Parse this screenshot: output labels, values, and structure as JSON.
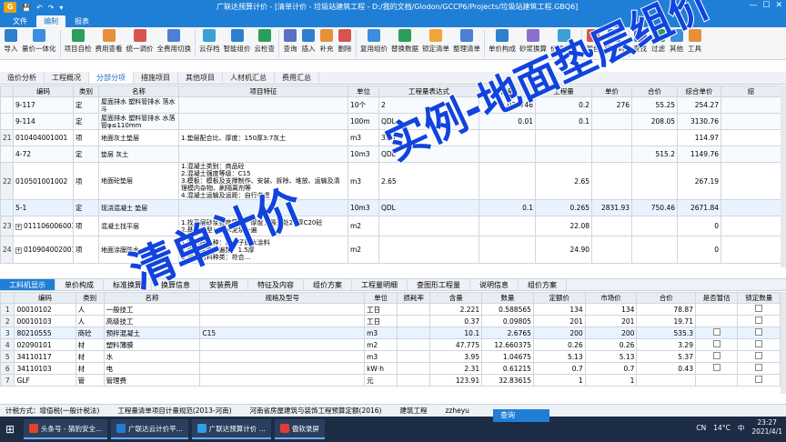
{
  "window": {
    "title": "广联达预算计价 - [清单计价 - 垃圾站建筑工程 - D:/我的文档/Glodon/GCCP6/Projects/垃圾站建筑工程.GBQ6]",
    "logo": "G",
    "controls": [
      "—",
      "☐",
      "✕"
    ]
  },
  "menu": {
    "tabs": [
      "文件",
      "编制",
      "报表"
    ],
    "active": 1
  },
  "ribbon": {
    "buttons": [
      {
        "label": "导入",
        "color": "#2f7fd0"
      },
      {
        "label": "量价一体化",
        "color": "#3b8ee0"
      },
      {
        "label": "项目自检",
        "color": "#2d9d5c"
      },
      {
        "label": "费用查看",
        "color": "#e6903a"
      },
      {
        "label": "统一调价",
        "color": "#d9544f"
      },
      {
        "label": "全费用切换",
        "color": "#4c7fd6"
      },
      {
        "label": "云存档",
        "color": "#3aa0d8"
      },
      {
        "label": "智能组价",
        "color": "#2f7fd0"
      },
      {
        "label": "云检查",
        "color": "#2d9d5c"
      },
      {
        "label": "查询",
        "color": "#5b6fc8"
      },
      {
        "label": "插入",
        "color": "#2f7fd0"
      },
      {
        "label": "补充",
        "color": "#e6903a"
      },
      {
        "label": "删除",
        "color": "#d9544f"
      },
      {
        "label": "复用组价",
        "color": "#3b8ee0"
      },
      {
        "label": "替换数据",
        "color": "#2d9d5c"
      },
      {
        "label": "锁定清单",
        "color": "#f0a43a"
      },
      {
        "label": "整理清单",
        "color": "#4c7fd6"
      },
      {
        "label": "单价构成",
        "color": "#2f7fd0"
      },
      {
        "label": "砂浆换算",
        "color": "#8b6fd0"
      },
      {
        "label": "价格指数",
        "color": "#3aa0d8"
      },
      {
        "label": "颜色",
        "color": "#d9544f"
      },
      {
        "label": "展开到",
        "color": "#2f7fd0"
      },
      {
        "label": "查找",
        "color": "#5b6fc8"
      },
      {
        "label": "过滤",
        "color": "#2d9d5c"
      },
      {
        "label": "其他",
        "color": "#3b8ee0"
      },
      {
        "label": "工具",
        "color": "#e6903a"
      }
    ]
  },
  "section_tabs": {
    "items": [
      "造价分析",
      "工程概况",
      "分部分项",
      "措施项目",
      "其他项目",
      "人材机汇总",
      "费用汇总"
    ],
    "active": 2
  },
  "upper_grid": {
    "headers": [
      "",
      "编码",
      "类别",
      "名称",
      "项目特征",
      "单位",
      "工程量表达式",
      "含量",
      "工程量",
      "单价",
      "合价",
      "综合单价",
      "综"
    ],
    "rows": [
      {
        "no": "",
        "code": "9-117",
        "type": "定",
        "name": "屋面排水 塑料管排水 落水斗",
        "feature": "",
        "unit": "10个",
        "expr": "2",
        "content": "0.031746",
        "qty": "0.2",
        "price": "276",
        "total": "55.25",
        "comp": "254.27",
        "dep": true
      },
      {
        "no": "",
        "code": "9-114",
        "type": "定",
        "name": "屋面排水 塑料管排水 水落管φ≤110mm",
        "feature": "",
        "unit": "100m",
        "expr": "QDL",
        "content": "0.01",
        "qty": "0.1",
        "price": "",
        "total": "208.05",
        "comp": "3130.76",
        "dep": true
      },
      {
        "no": "21",
        "code": "010404001001",
        "type": "项",
        "name": "地面灰土垫层",
        "feature": "1.垫层配合比、厚度：150厚3:7灰土",
        "unit": "m3",
        "expr": "3.31",
        "content": "",
        "qty": "",
        "price": "",
        "total": "",
        "comp": "114.97"
      },
      {
        "no": "",
        "code": "4-72",
        "type": "定",
        "name": "垫层 灰土",
        "feature": "",
        "unit": "10m3",
        "expr": "QDL",
        "content": "",
        "qty": "",
        "price": "",
        "total": "515.2",
        "comp": "1149.76",
        "dep": true
      },
      {
        "no": "22",
        "code": "010501001002",
        "type": "项",
        "name": "地面砼垫层",
        "feature": "1.混凝土类别：商品砼\n2.混凝土强度等级：C15\n3.模板：模板及支撑制作、安装、拆除、堆放、运输及清理模内杂物、刷隔离剂等\n4.混凝土运输及运距：自行考虑",
        "unit": "m3",
        "expr": "2.65",
        "content": "",
        "qty": "2.65",
        "price": "",
        "total": "",
        "comp": "267.19"
      },
      {
        "no": "",
        "code": "5-1",
        "type": "定",
        "name": "现浇混凝土 垫层",
        "feature": "",
        "unit": "10m3",
        "expr": "QDL",
        "content": "0.1",
        "qty": "0.265",
        "price": "2831.93",
        "total": "750.46",
        "comp": "2671.84",
        "dep": true,
        "sel": true
      },
      {
        "no": "23",
        "code": "011106006003",
        "type": "项",
        "name": "混凝土找平层",
        "feature": "1.找平层砂浆强度等级、厚度：最薄处20厚C20砼\n2.基层类型：素水泥浆一遍",
        "unit": "m2",
        "expr": "",
        "content": "",
        "qty": "22.08",
        "price": "",
        "total": "",
        "comp": "0",
        "expand": true
      },
      {
        "no": "24",
        "code": "010904002001",
        "type": "项",
        "name": "地面涂膜防水",
        "feature": "1.防水膜品种：高分子防水涂料\n2.涂膜厚度、遍数：1.5厚\n3.增强材料种类：符合…",
        "unit": "m2",
        "expr": "",
        "content": "",
        "qty": "24.90",
        "price": "",
        "total": "",
        "comp": "0",
        "expand": true
      }
    ]
  },
  "lower_tabs": {
    "items": [
      "工料机显示",
      "单价构成",
      "标准换算",
      "换算信息",
      "安装费用",
      "特征及内容",
      "组价方案",
      "工程量明细",
      "查图形工程量",
      "说明信息",
      "组价方案"
    ],
    "active": 0
  },
  "lower_grid": {
    "headers": [
      "",
      "编码",
      "类别",
      "名称",
      "规格及型号",
      "单位",
      "损耗率",
      "含量",
      "数量",
      "定额价",
      "市场价",
      "合价",
      "是否暂估",
      "锁定数量"
    ],
    "rows": [
      {
        "no": "1",
        "code": "00010102",
        "type": "人",
        "name": "一般技工",
        "spec": "",
        "unit": "工日",
        "loss": "",
        "content": "2.221",
        "qty": "0.588565",
        "base": "134",
        "market": "134",
        "total": "78.87",
        "est": false
      },
      {
        "no": "2",
        "code": "00010103",
        "type": "人",
        "name": "高级技工",
        "spec": "",
        "unit": "工日",
        "loss": "",
        "content": "0.37",
        "qty": "0.09805",
        "base": "201",
        "market": "201",
        "total": "19.71",
        "est": false
      },
      {
        "no": "3",
        "code": "80210555",
        "type": "商砼",
        "name": "预拌混凝土",
        "spec": "C15",
        "unit": "m3",
        "loss": "",
        "content": "10.1",
        "qty": "2.6765",
        "base": "200",
        "market": "200",
        "total": "535.3",
        "est": true,
        "sel": true
      },
      {
        "no": "4",
        "code": "02090101",
        "type": "材",
        "name": "塑料薄膜",
        "spec": "",
        "unit": "m2",
        "loss": "",
        "content": "47.775",
        "qty": "12.660375",
        "base": "0.26",
        "market": "0.26",
        "total": "3.29",
        "est": true
      },
      {
        "no": "5",
        "code": "34110117",
        "type": "材",
        "name": "水",
        "spec": "",
        "unit": "m3",
        "loss": "",
        "content": "3.95",
        "qty": "1.04675",
        "base": "5.13",
        "market": "5.13",
        "total": "5.37",
        "est": true
      },
      {
        "no": "6",
        "code": "34110103",
        "type": "材",
        "name": "电",
        "spec": "",
        "unit": "kW·h",
        "loss": "",
        "content": "2.31",
        "qty": "0.61215",
        "base": "0.7",
        "market": "0.7",
        "total": "0.43",
        "est": true
      },
      {
        "no": "7",
        "code": "GLF",
        "type": "管",
        "name": "管理费",
        "spec": "",
        "unit": "元",
        "loss": "",
        "content": "123.91",
        "qty": "32.83615",
        "base": "1",
        "market": "1",
        "total": "",
        "est": false
      }
    ]
  },
  "status": {
    "items": [
      "计税方式：增值税(一般计税法)",
      "工程量清单项目计量规范(2013-河南)",
      "河南省房屋建筑与装饰工程预算定额(2016)",
      "建筑工程",
      "zzheyu"
    ]
  },
  "taskbar": {
    "items": [
      {
        "label": "头条号 - 猜豹安全...",
        "color": "#e0442d"
      },
      {
        "label": "广联达云计价平...",
        "color": "#1f7fd6"
      },
      {
        "label": "广联达预算计价 ...",
        "color": "#2f9fe8"
      },
      {
        "label": "傲软录屏",
        "color": "#e23b3b"
      }
    ],
    "search_label": "查询",
    "tray": {
      "lang": "CN",
      "temp": "14°C",
      "ime": "中",
      "time": "23:27",
      "date": "2021/4/1"
    }
  },
  "overlay": {
    "line1": "实例-地面垫层组价",
    "line2": "清单计价"
  },
  "colors": {
    "titlebar": "#1f7fd6",
    "overlay_text": "#1144dd"
  }
}
